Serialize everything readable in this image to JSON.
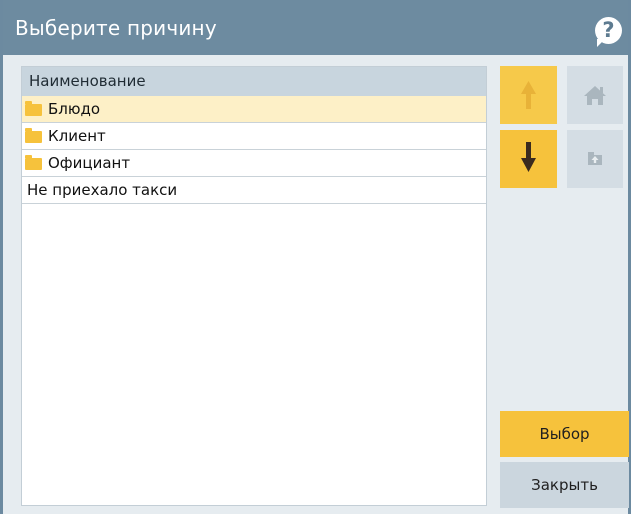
{
  "dialog": {
    "title": "Выберите причину",
    "help_icon": "question-bubble-icon",
    "help_glyph": "?"
  },
  "list": {
    "column_header": "Наименование",
    "rows": [
      {
        "label": "Блюдо",
        "type": "folder",
        "selected": true
      },
      {
        "label": "Клиент",
        "type": "folder",
        "selected": false
      },
      {
        "label": "Официант",
        "type": "folder",
        "selected": false
      },
      {
        "label": "Не приехало такси",
        "type": "item",
        "selected": false
      }
    ]
  },
  "nav": {
    "up_icon": "arrow-up-icon",
    "down_icon": "arrow-down-icon",
    "home_icon": "home-icon",
    "parent_folder_icon": "folder-up-icon"
  },
  "actions": {
    "select_label": "Выбор",
    "close_label": "Закрыть"
  },
  "colors": {
    "titlebar": "#6d8ba0",
    "accent": "#f6c23c",
    "selected_row": "#fdf0c7",
    "disabled_button": "#d4dde4"
  }
}
